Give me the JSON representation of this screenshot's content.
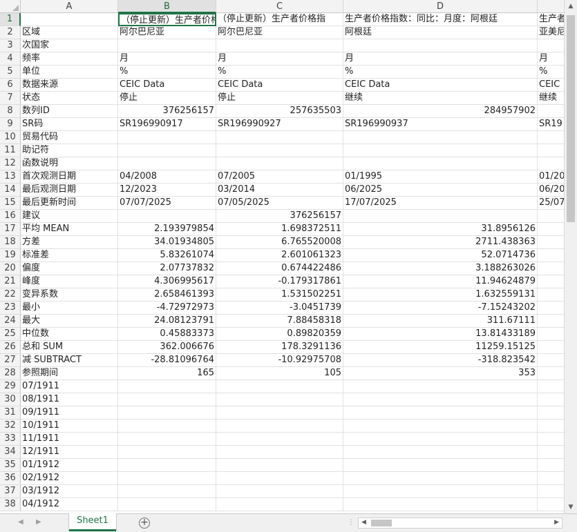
{
  "columns": [
    "A",
    "B",
    "C",
    "D",
    ""
  ],
  "selected_column": "B",
  "selected_row": "1",
  "rows": [
    {
      "n": "1",
      "a": "",
      "b": "（停止更新）生产者价格",
      "c": "（停止更新）生产者价格指",
      "d": "生产者价格指数：同比：月度：阿根廷",
      "e": "生产者"
    },
    {
      "n": "2",
      "a": "区域",
      "b": "阿尔巴尼亚",
      "c": "阿尔巴尼亚",
      "d": "阿根廷",
      "e": "亚美尼"
    },
    {
      "n": "3",
      "a": "次国家",
      "b": "",
      "c": "",
      "d": "",
      "e": ""
    },
    {
      "n": "4",
      "a": "频率",
      "b": "月",
      "c": "月",
      "d": "月",
      "e": "月"
    },
    {
      "n": "5",
      "a": "单位",
      "b": "%",
      "c": "%",
      "d": "%",
      "e": "%"
    },
    {
      "n": "6",
      "a": "数据来源",
      "b": "CEIC Data",
      "c": "CEIC Data",
      "d": "CEIC Data",
      "e": "CEIC"
    },
    {
      "n": "7",
      "a": "状态",
      "b": "停止",
      "c": "停止",
      "d": "继续",
      "e": "继续"
    },
    {
      "n": "8",
      "a": "数列ID",
      "b": "376256157",
      "c": "257635503",
      "d": "284957902",
      "e": ""
    },
    {
      "n": "9",
      "a": "SR码",
      "b": "SR196990917",
      "c": "SR196990927",
      "d": "SR196990937",
      "e": "SR19"
    },
    {
      "n": "10",
      "a": "贸易代码",
      "b": "",
      "c": "",
      "d": "",
      "e": ""
    },
    {
      "n": "11",
      "a": "助记符",
      "b": "",
      "c": "",
      "d": "",
      "e": ""
    },
    {
      "n": "12",
      "a": "函数说明",
      "b": "",
      "c": "",
      "d": "",
      "e": ""
    },
    {
      "n": "13",
      "a": "首次观测日期",
      "b": "04/2008",
      "c": "07/2005",
      "d": "01/1995",
      "e": "01/20"
    },
    {
      "n": "14",
      "a": "最后观测日期",
      "b": "12/2023",
      "c": "03/2014",
      "d": "06/2025",
      "e": "06/20"
    },
    {
      "n": "15",
      "a": "最后更新时间",
      "b": "07/07/2025",
      "c": "07/05/2025",
      "d": "17/07/2025",
      "e": "25/07"
    },
    {
      "n": "16",
      "a": "建议",
      "b": "",
      "c": "376256157",
      "d": "",
      "e": ""
    },
    {
      "n": "17",
      "a": "平均 MEAN",
      "b": "2.193979854",
      "c": "1.698372511",
      "d": "31.8956126",
      "e": ""
    },
    {
      "n": "18",
      "a": "方差",
      "b": "34.01934805",
      "c": "6.765520008",
      "d": "2711.438363",
      "e": ""
    },
    {
      "n": "19",
      "a": "标准差",
      "b": "5.83261074",
      "c": "2.601061323",
      "d": "52.0714736",
      "e": ""
    },
    {
      "n": "20",
      "a": "偏度",
      "b": "2.07737832",
      "c": "0.674422486",
      "d": "3.188263026",
      "e": ""
    },
    {
      "n": "21",
      "a": "峰度",
      "b": "4.306995617",
      "c": "-0.179317861",
      "d": "11.94624879",
      "e": ""
    },
    {
      "n": "22",
      "a": "变异系数",
      "b": "2.658461393",
      "c": "1.531502251",
      "d": "1.632559131",
      "e": ""
    },
    {
      "n": "23",
      "a": "最小",
      "b": "-4.72972973",
      "c": "-3.0451739",
      "d": "-7.15243202",
      "e": ""
    },
    {
      "n": "24",
      "a": "最大",
      "b": "24.08123791",
      "c": "7.88458318",
      "d": "311.67111",
      "e": ""
    },
    {
      "n": "25",
      "a": "中位数",
      "b": "0.45883373",
      "c": "0.89820359",
      "d": "13.81433189",
      "e": ""
    },
    {
      "n": "26",
      "a": "总和 SUM",
      "b": "362.006676",
      "c": "178.3291136",
      "d": "11259.15125",
      "e": ""
    },
    {
      "n": "27",
      "a": "减 SUBTRACT",
      "b": "-28.81096764",
      "c": "-10.92975708",
      "d": "-318.823542",
      "e": ""
    },
    {
      "n": "28",
      "a": "参照期间",
      "b": "165",
      "c": "105",
      "d": "353",
      "e": ""
    },
    {
      "n": "29",
      "a": "07/1911",
      "b": "",
      "c": "",
      "d": "",
      "e": ""
    },
    {
      "n": "30",
      "a": "08/1911",
      "b": "",
      "c": "",
      "d": "",
      "e": ""
    },
    {
      "n": "31",
      "a": "09/1911",
      "b": "",
      "c": "",
      "d": "",
      "e": ""
    },
    {
      "n": "32",
      "a": "10/1911",
      "b": "",
      "c": "",
      "d": "",
      "e": ""
    },
    {
      "n": "33",
      "a": "11/1911",
      "b": "",
      "c": "",
      "d": "",
      "e": ""
    },
    {
      "n": "34",
      "a": "12/1911",
      "b": "",
      "c": "",
      "d": "",
      "e": ""
    },
    {
      "n": "35",
      "a": "01/1912",
      "b": "",
      "c": "",
      "d": "",
      "e": ""
    },
    {
      "n": "36",
      "a": "02/1912",
      "b": "",
      "c": "",
      "d": "",
      "e": ""
    },
    {
      "n": "37",
      "a": "03/1912",
      "b": "",
      "c": "",
      "d": "",
      "e": ""
    },
    {
      "n": "38",
      "a": "04/1912",
      "b": "",
      "c": "",
      "d": "",
      "e": ""
    }
  ],
  "sheet_tab": "Sheet1",
  "add_sheet_icon": "plus-circle-icon",
  "accent_color": "#217346"
}
